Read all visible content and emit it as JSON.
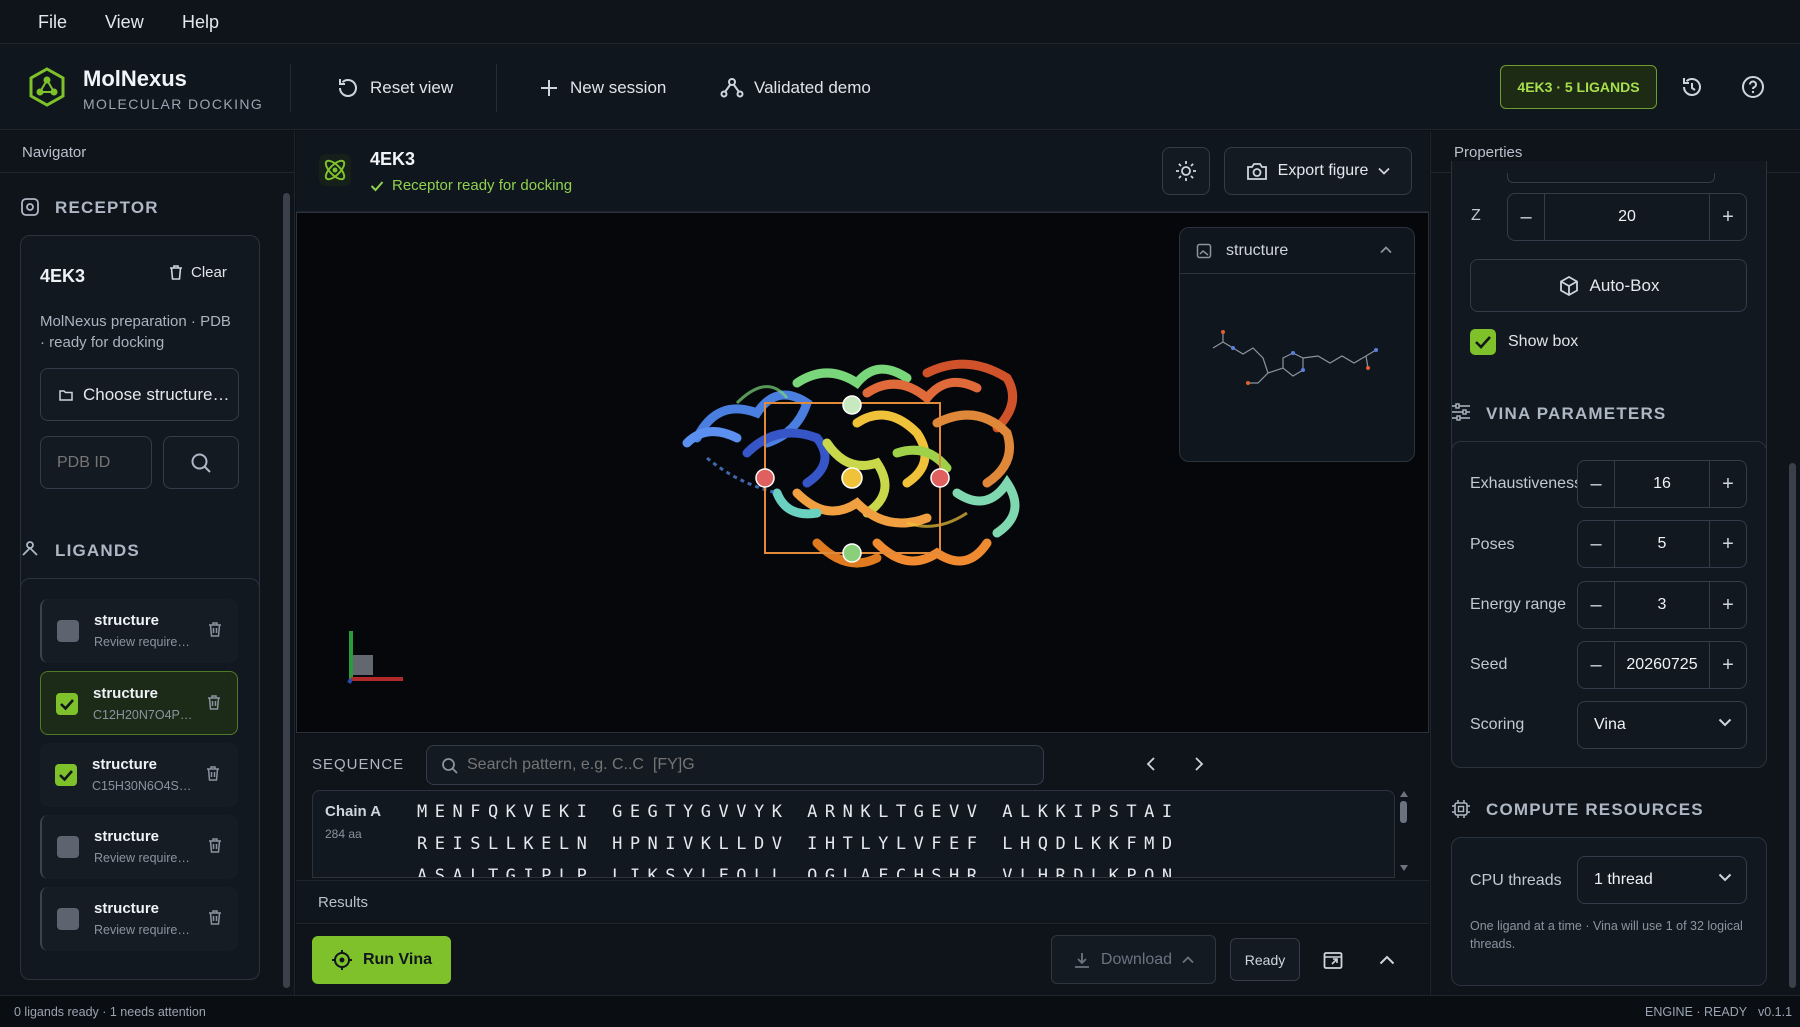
{
  "menu": [
    "File",
    "View",
    "Help"
  ],
  "app": {
    "name": "MolNexus",
    "subtitle": "MOLECULAR DOCKING"
  },
  "toolbar": {
    "reset": "Reset view",
    "new_session": "New session",
    "demo": "Validated demo",
    "badge": "4EK3 · 5 LIGANDS"
  },
  "navigator": {
    "title": "Navigator",
    "receptor_heading": "RECEPTOR",
    "receptor": {
      "name": "4EK3",
      "clear": "Clear",
      "desc": "MolNexus preparation · PDB · ready for docking",
      "choose": "Choose structure…",
      "pdb_placeholder": "PDB ID"
    },
    "ligands_heading": "LIGANDS",
    "ligands": [
      {
        "name": "structure",
        "sub": "Review require…",
        "checked": false
      },
      {
        "name": "structure",
        "sub": "C12H20N7O4P…",
        "checked": true
      },
      {
        "name": "structure",
        "sub": "C15H30N6O4S…",
        "checked": true
      },
      {
        "name": "structure",
        "sub": "Review require…",
        "checked": false
      },
      {
        "name": "structure",
        "sub": "Review require…",
        "checked": false
      }
    ]
  },
  "viewer": {
    "title": "4EK3",
    "status": "Receptor ready for docking",
    "export": "Export figure",
    "inset_title": "structure"
  },
  "sequence": {
    "label": "SEQUENCE",
    "search_placeholder": "Search pattern, e.g. C..C  [FY]G",
    "chain": "Chain A",
    "length": "284 aa",
    "rows": [
      "MENFQKVEKI GEGTYGVVYK ARNKLTGEVV ALKKIPSTAI",
      "REISLLKELN HPNIVKLLDV IHTLYLVFEF LHQDLKKFMD",
      "ASALTGIPLP LIKSYLFQLL QGLAFCHSHR VLHRDLKPQN"
    ]
  },
  "results": {
    "label": "Results",
    "run": "Run Vina",
    "download": "Download",
    "ready": "Ready"
  },
  "properties": {
    "title": "Properties",
    "z_label": "Z",
    "z_value": "20",
    "autobox": "Auto-Box",
    "show_box": "Show box",
    "vina_heading": "VINA PARAMETERS",
    "params": [
      {
        "label": "Exhaustiveness",
        "value": "16"
      },
      {
        "label": "Poses",
        "value": "5"
      },
      {
        "label": "Energy range",
        "value": "3"
      },
      {
        "label": "Seed",
        "value": "20260725"
      }
    ],
    "scoring_label": "Scoring",
    "scoring_value": "Vina",
    "compute_heading": "COMPUTE RESOURCES",
    "cpu_label": "CPU threads",
    "cpu_value": "1 thread",
    "cpu_note": "One ligand at a time · Vina will use 1 of 32 logical threads."
  },
  "statusbar": {
    "left": "0 ligands ready · 1 needs attention",
    "engine": "ENGINE · READY",
    "version": "v0.1.1"
  },
  "colors": {
    "accent": "#7ec12a",
    "bg": "#0d1117"
  },
  "icons": [
    "logo-icon",
    "reset-icon",
    "plus-icon",
    "demo-icon",
    "history-icon",
    "help-icon",
    "receptor-icon",
    "trash-icon",
    "folder-icon",
    "search-icon",
    "ligands-icon",
    "atom-icon",
    "check-icon",
    "sun-icon",
    "camera-icon",
    "chevron-down-icon",
    "image-icon",
    "chevron-up-icon",
    "chevron-left-icon",
    "chevron-right-icon",
    "autobox-icon",
    "sliders-icon",
    "cpu-icon",
    "target-icon",
    "download-icon",
    "popout-icon"
  ]
}
